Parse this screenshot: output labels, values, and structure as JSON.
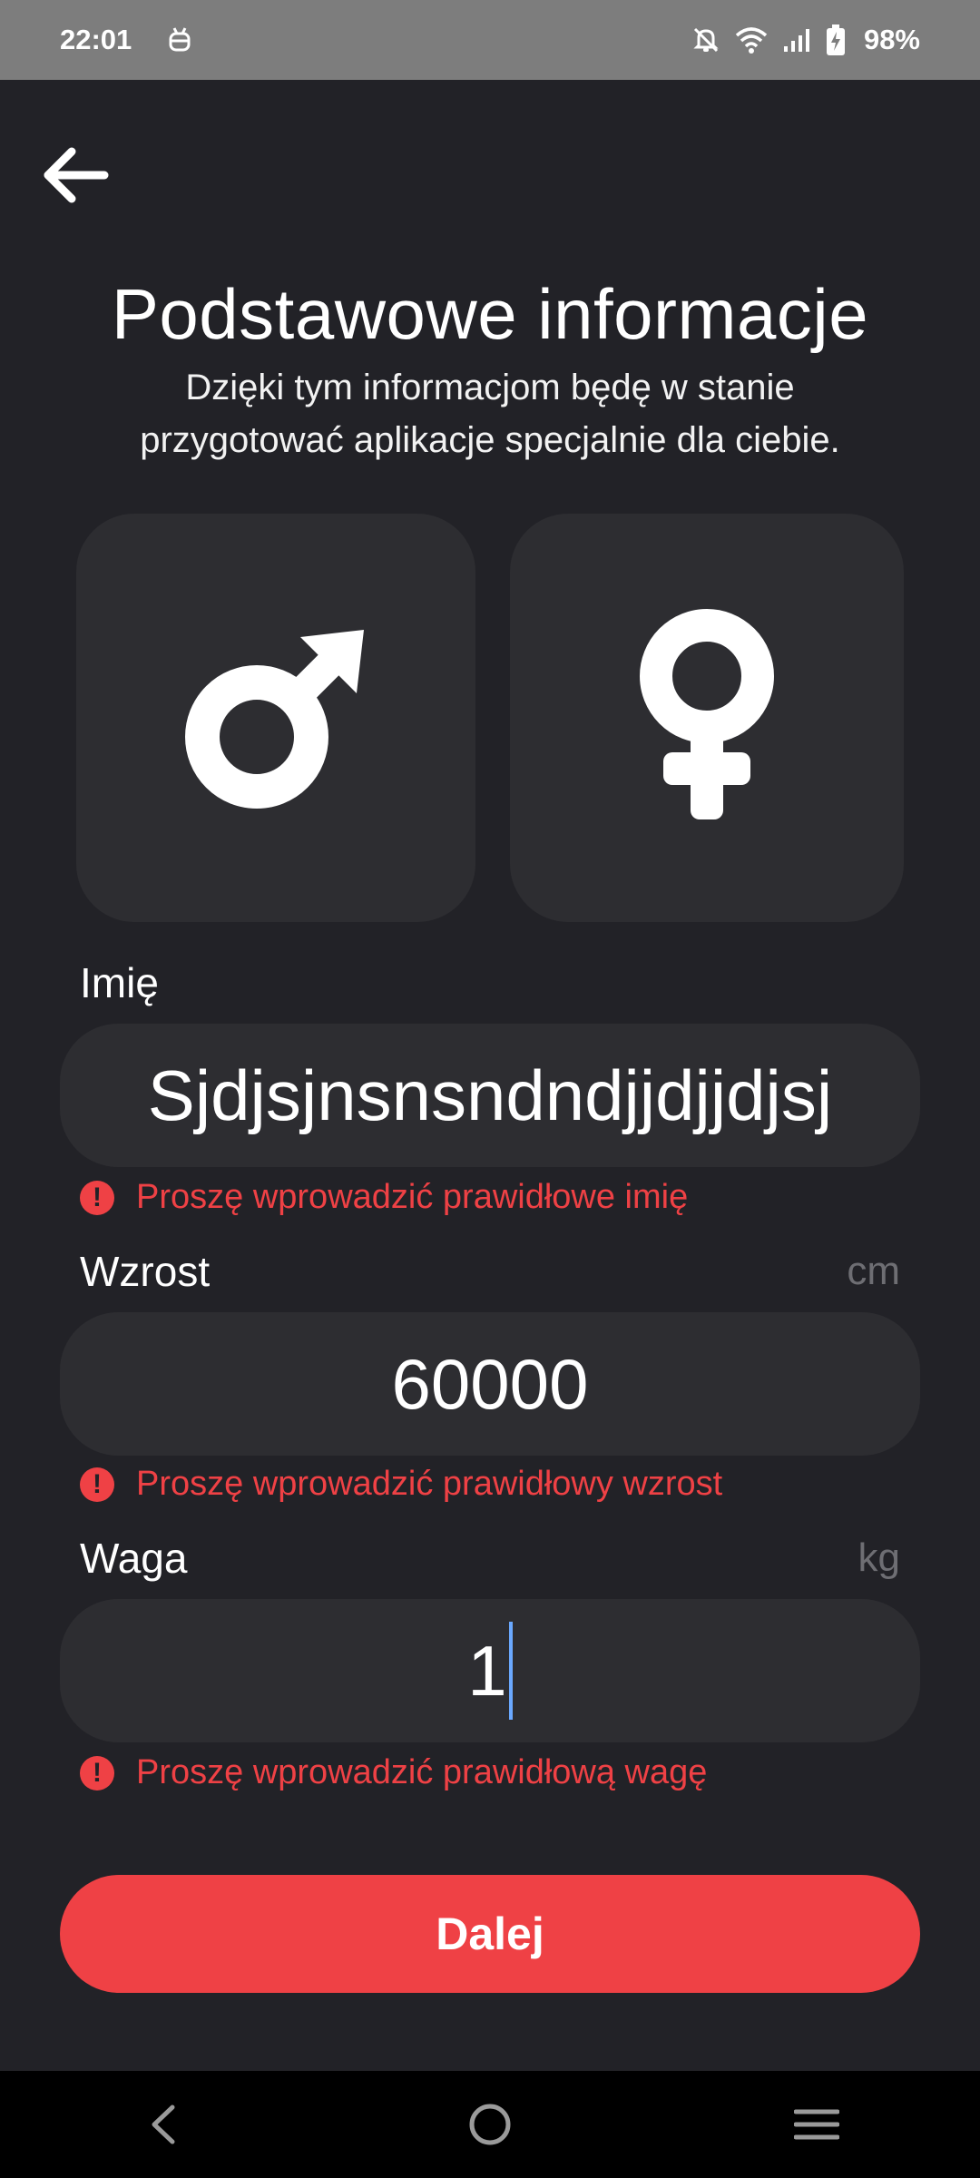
{
  "status_bar": {
    "time": "22:01",
    "notification_icon": "android-debug-icon",
    "icons": [
      "bell-off-icon",
      "wifi-icon",
      "signal-icon",
      "battery-charging-icon"
    ],
    "battery": "98%"
  },
  "header": {
    "back_icon": "arrow-left-icon",
    "title": "Podstawowe informacje",
    "subtitle": "Dzięki tym informacjom będę w stanie przygotować aplikacje specjalnie dla ciebie."
  },
  "gender": {
    "options": [
      {
        "id": "male",
        "icon": "male-symbol-icon"
      },
      {
        "id": "female",
        "icon": "female-symbol-icon"
      }
    ]
  },
  "form": {
    "name": {
      "label": "Imię",
      "value": "Sjdjsjnsnsndndjjdjjdjsj",
      "error": "Proszę wprowadzić prawidłowe imię"
    },
    "height": {
      "label": "Wzrost",
      "unit": "cm",
      "value": "60000",
      "error": "Proszę wprowadzić prawidłowy wzrost"
    },
    "weight": {
      "label": "Waga",
      "unit": "kg",
      "value": "1",
      "error": "Proszę wprowadzić prawidłową wagę"
    }
  },
  "actions": {
    "next_label": "Dalej"
  },
  "nav_bar": {
    "buttons": [
      "back-nav-icon",
      "home-nav-icon",
      "recents-nav-icon"
    ]
  },
  "colors": {
    "background": "#222227",
    "card": "#2d2d31",
    "accent": "#ef4145",
    "error": "#ef4145",
    "status_bar": "#7d7d7d",
    "cursor": "#6aa8ff"
  }
}
